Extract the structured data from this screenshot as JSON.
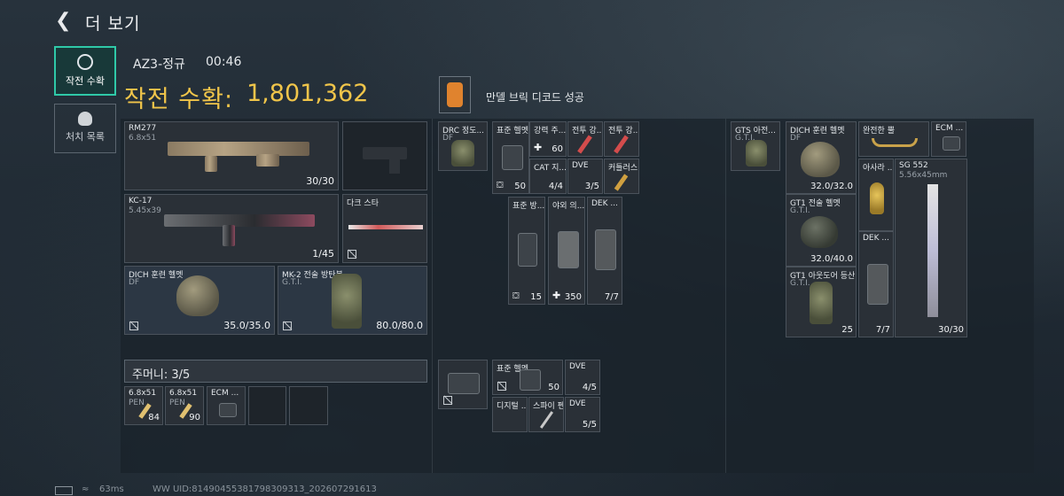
{
  "header": {
    "back_icon": "back-arrow-icon",
    "title": "더 보기"
  },
  "nav": {
    "harvest_label": "작전 수확",
    "kills_label": "처치 목록"
  },
  "match": {
    "mode": "AZ3-정규",
    "time": "00:46"
  },
  "haul": {
    "label": "작전 수확:",
    "value": "1,801,362"
  },
  "event": {
    "icon": "decode-icon",
    "text": "만델 브릭 디코드 성공"
  },
  "equipment": {
    "primary": {
      "name": "RM277",
      "ammo": "6.8x51",
      "count": "30/30"
    },
    "secondary": {
      "name": "KC-17",
      "ammo": "5.45x39",
      "count": "1/45"
    },
    "melee": {
      "name": "다크 스타"
    },
    "helmet": {
      "name": "DICH 훈련 헬멧",
      "maker": "DF",
      "durability": "35.0/35.0"
    },
    "armor": {
      "name": "MK-2 전술 방탄복",
      "maker": "G.T.I.",
      "durability": "80.0/80.0"
    }
  },
  "pouch": {
    "label": "주머니: 3/5",
    "items": [
      {
        "name": "6.8x51",
        "sub": "PEN",
        "count": "84"
      },
      {
        "name": "6.8x51",
        "sub": "PEN",
        "count": "90"
      },
      {
        "name": "ECM ..."
      }
    ]
  },
  "backpack": {
    "rig": {
      "name": "DRC 정도...",
      "sub": "DF"
    },
    "items": [
      {
        "name": "표준 헬멧...",
        "value": "50"
      },
      {
        "name": "강력 주...",
        "value": "60"
      },
      {
        "name": "CAT 지...",
        "value": "4/4"
      },
      {
        "name": "전투 강...",
        "value": ""
      },
      {
        "name": "전투 강...",
        "value": ""
      },
      {
        "name": "DVE",
        "value": "3/5"
      },
      {
        "name": "커틀러스",
        "value": ""
      },
      {
        "name": "표준 방...",
        "value": "15"
      },
      {
        "name": "야외 의...",
        "value": "350"
      },
      {
        "name": "DEK ...",
        "value": "7/7"
      }
    ],
    "lower": [
      {
        "name": "표준 헬멧...",
        "value": "50"
      },
      {
        "name": "DVE",
        "value": "4/5"
      },
      {
        "name": "디지털 ...",
        "value": ""
      },
      {
        "name": "스파이 펜",
        "value": ""
      },
      {
        "name": "DVE",
        "value": "5/5"
      }
    ]
  },
  "stash": {
    "bag": {
      "name": "GTS 아전...",
      "sub": "G.T.I."
    },
    "items": [
      {
        "name": "DICH 훈련 헬멧",
        "sub": "DF",
        "value": "32.0/32.0"
      },
      {
        "name": "완전한 뿔",
        "value": ""
      },
      {
        "name": "ECM ...",
        "value": ""
      },
      {
        "name": "아사라 ...",
        "value": ""
      },
      {
        "name": "SG 552",
        "sub": "5.56x45mm",
        "value": "30/30"
      },
      {
        "name": "GT1 전술 헬멧",
        "sub": "G.T.I.",
        "value": "32.0/40.0"
      },
      {
        "name": "DEK ...",
        "value": "7/7"
      },
      {
        "name": "GT1 아웃도어 등산...",
        "sub": "G.T.I.",
        "value": "25"
      }
    ]
  },
  "footer": {
    "ping": "63ms",
    "uid": "WW UID:81490455381798309313_202607291613"
  }
}
